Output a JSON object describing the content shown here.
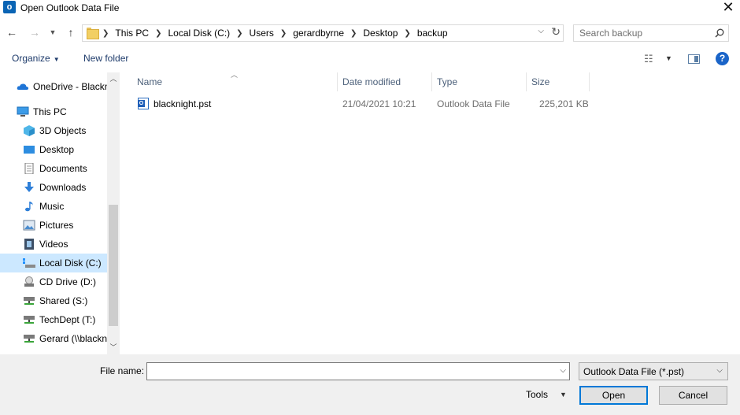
{
  "window": {
    "title": "Open Outlook Data File",
    "app_icon_letter": "o"
  },
  "nav_buttons": {
    "back": "←",
    "forward": "→",
    "recent": "⌄",
    "up": "↑"
  },
  "address": {
    "crumbs": [
      "This PC",
      "Local Disk (C:)",
      "Users",
      "gerardbyrne",
      "Desktop",
      "backup"
    ]
  },
  "search": {
    "placeholder": "Search backup"
  },
  "toolbar": {
    "organize_label": "Organize",
    "new_folder_label": "New folder"
  },
  "nav_pane": {
    "items": [
      {
        "label": "OneDrive - Blackn",
        "icon": "onedrive-icon",
        "selected": false
      },
      {
        "label": "This PC",
        "icon": "this-pc-icon",
        "selected": false
      },
      {
        "label": "3D Objects",
        "icon": "3d-objects-icon",
        "selected": false
      },
      {
        "label": "Desktop",
        "icon": "desktop-icon",
        "selected": false
      },
      {
        "label": "Documents",
        "icon": "documents-icon",
        "selected": false
      },
      {
        "label": "Downloads",
        "icon": "downloads-icon",
        "selected": false
      },
      {
        "label": "Music",
        "icon": "music-icon",
        "selected": false
      },
      {
        "label": "Pictures",
        "icon": "pictures-icon",
        "selected": false
      },
      {
        "label": "Videos",
        "icon": "videos-icon",
        "selected": false
      },
      {
        "label": "Local Disk (C:)",
        "icon": "local-disk-icon",
        "selected": true
      },
      {
        "label": "CD Drive (D:)",
        "icon": "cd-drive-icon",
        "selected": false
      },
      {
        "label": "Shared (S:)",
        "icon": "network-drive-icon",
        "selected": false
      },
      {
        "label": "TechDept (T:)",
        "icon": "network-drive-icon",
        "selected": false
      },
      {
        "label": "Gerard (\\\\blackn",
        "icon": "network-drive-icon",
        "selected": false
      }
    ]
  },
  "file_list": {
    "columns": [
      "Name",
      "Date modified",
      "Type",
      "Size"
    ],
    "rows": [
      {
        "name": "blacknight.pst",
        "date_modified": "21/04/2021 10:21",
        "type": "Outlook Data File",
        "size": "225,201 KB"
      }
    ]
  },
  "footer": {
    "file_name_label": "File name:",
    "file_name_value": "",
    "file_type_selected": "Outlook Data File (*.pst)",
    "tools_label": "Tools",
    "open_label": "Open",
    "cancel_label": "Cancel"
  },
  "colors": {
    "accent": "#0078d7",
    "selected_bg": "#cce8ff",
    "help_blue": "#1a64c8"
  }
}
